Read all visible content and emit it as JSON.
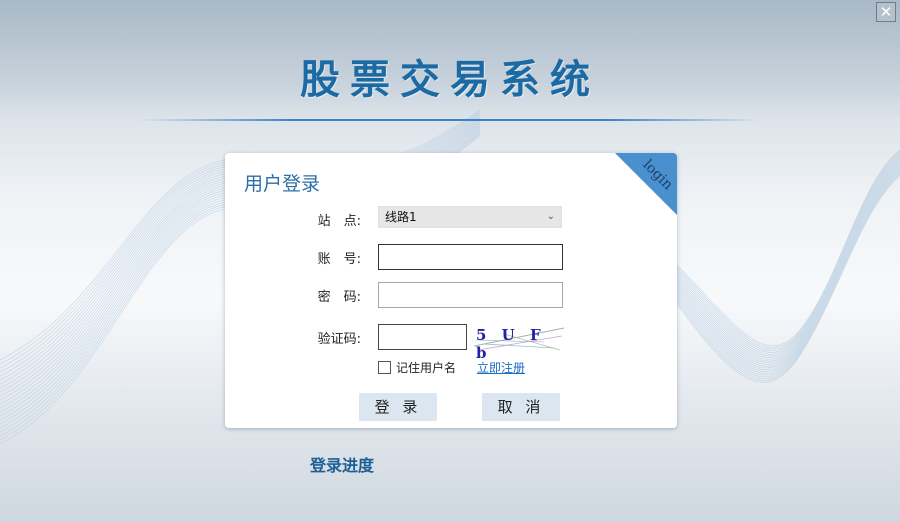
{
  "window": {
    "close_icon": "close-icon",
    "close_glyph": "✕"
  },
  "header": {
    "app_title": "股票交易系统"
  },
  "login_panel": {
    "title": "用户登录",
    "corner_badge": "login",
    "fields": {
      "site": {
        "label": "站　点:",
        "value": "线路1",
        "chevron": "⌄"
      },
      "account": {
        "label": "账　号:",
        "value": ""
      },
      "password": {
        "label": "密　码:",
        "value": ""
      },
      "captcha": {
        "label": "验证码:",
        "value": "",
        "image_text": "5 U F b"
      }
    },
    "remember_username": {
      "label": "记住用户名",
      "checked": false
    },
    "register_link": "立即注册",
    "buttons": {
      "login": "登 录",
      "cancel": "取 消"
    }
  },
  "footer": {
    "progress_label": "登录进度"
  },
  "colors": {
    "accent": "#1c6aa3",
    "corner": "#4a90cf",
    "button_bg": "#dce6f0",
    "link": "#1b6bc7"
  }
}
